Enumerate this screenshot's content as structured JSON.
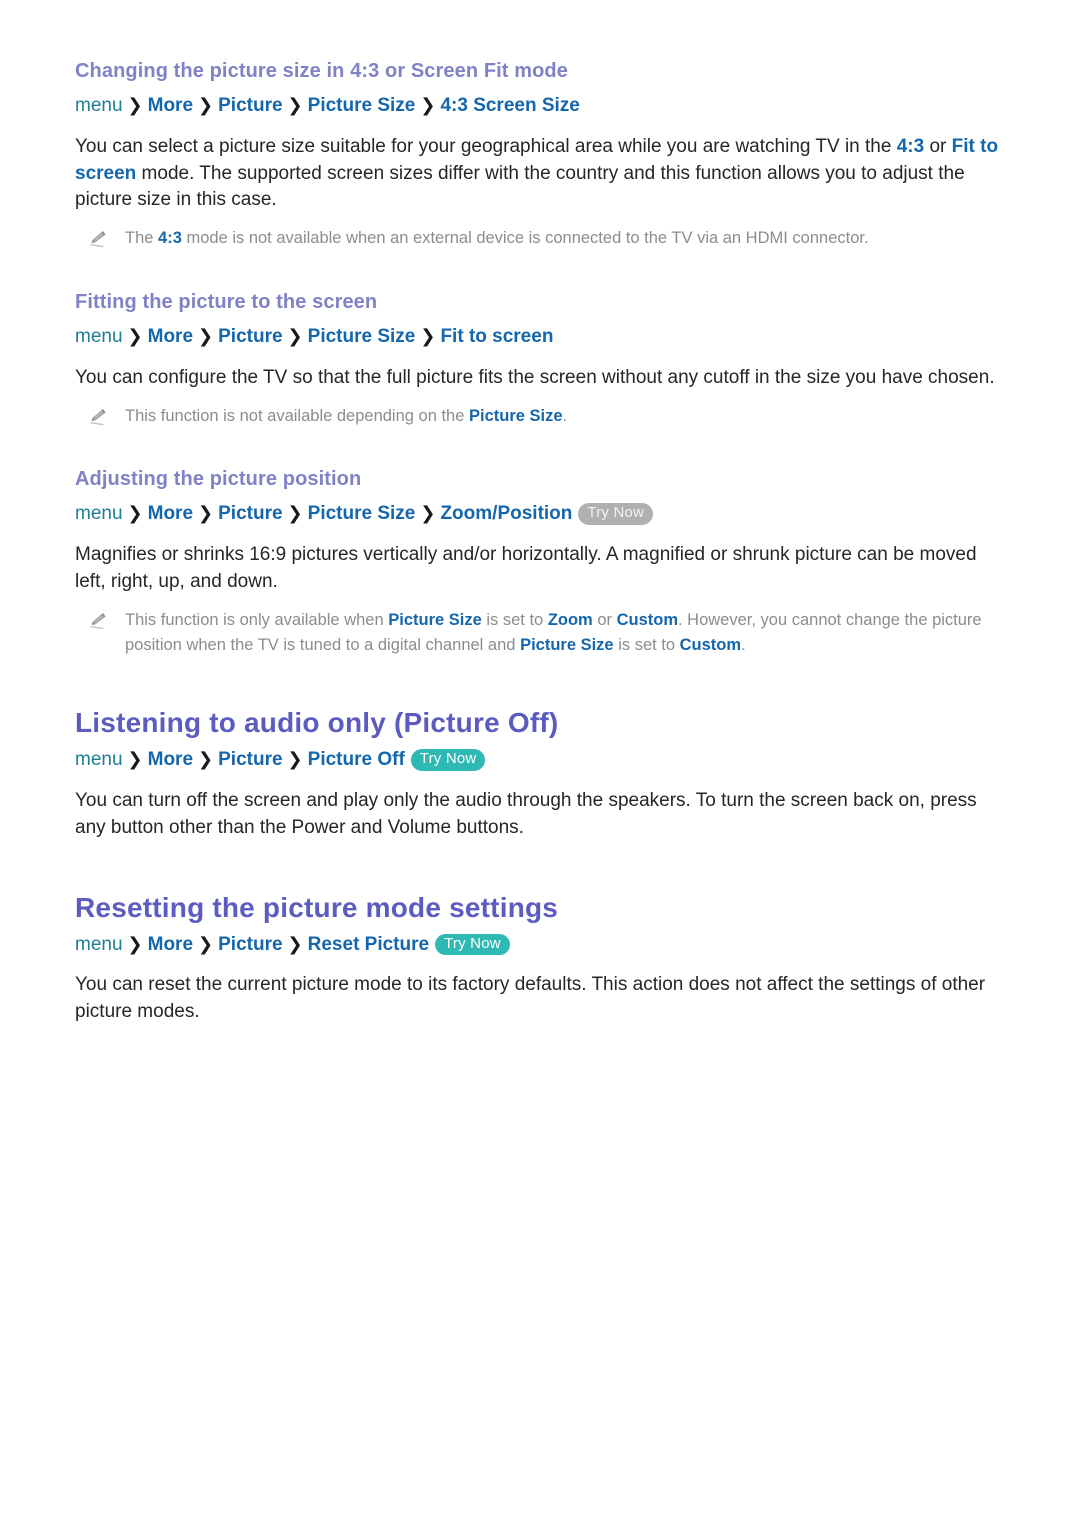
{
  "colors": {
    "main_heading": "#5c5cc0",
    "sub_heading": "#8181c6",
    "crumb_menu": "#1d7f94",
    "crumb_link": "#1466ad",
    "highlight": "#1466ad",
    "note_text": "#8c8c8c",
    "try_now_active": "#2fb9b5",
    "try_now_muted": "#b0b0b0",
    "body_text": "#262626",
    "page_background": "#ffffff"
  },
  "sections": [
    {
      "id": "changing-picture-size",
      "level": "sub",
      "heading": "Changing the picture size in 4:3 or Screen Fit mode",
      "breadcrumb": {
        "root": "menu",
        "separator": "›",
        "crumbs": [
          "More",
          "Picture",
          "Picture Size",
          "4:3 Screen Size"
        ],
        "try_now": null
      },
      "paragraphs": [
        {
          "runs": [
            {
              "t": "You can select a picture size suitable for your geographical area while you are watching TV in the ",
              "b": false
            },
            {
              "t": "4:3",
              "b": true
            },
            {
              "t": " or ",
              "b": false
            },
            {
              "t": "Fit to screen",
              "b": true
            },
            {
              "t": " mode. The supported screen sizes differ with the country and this function allows you to adjust the picture size in this case.",
              "b": false
            }
          ]
        }
      ],
      "notes": [
        {
          "icon": "pencil-icon",
          "runs": [
            {
              "t": "The ",
              "b": false
            },
            {
              "t": "4:3",
              "b": true
            },
            {
              "t": " mode is not available when an external device is connected to the TV via an HDMI connector.",
              "b": false
            }
          ]
        }
      ]
    },
    {
      "id": "fitting-picture-to-screen",
      "level": "sub",
      "heading": "Fitting the picture to the screen",
      "breadcrumb": {
        "root": "menu",
        "separator": "›",
        "crumbs": [
          "More",
          "Picture",
          "Picture Size",
          "Fit to screen"
        ],
        "try_now": null
      },
      "paragraphs": [
        {
          "runs": [
            {
              "t": "You can configure the TV so that the full picture fits the screen without any cutoff in the size you have chosen.",
              "b": false
            }
          ]
        }
      ],
      "notes": [
        {
          "icon": "pencil-icon",
          "runs": [
            {
              "t": "This function is not available depending on the ",
              "b": false
            },
            {
              "t": "Picture Size",
              "b": true
            },
            {
              "t": ".",
              "b": false
            }
          ]
        }
      ]
    },
    {
      "id": "adjusting-picture-position",
      "level": "sub",
      "heading": "Adjusting the picture position",
      "breadcrumb": {
        "root": "menu",
        "separator": "›",
        "crumbs": [
          "More",
          "Picture",
          "Picture Size",
          "Zoom/Position"
        ],
        "try_now": {
          "label": "Try Now",
          "style": "muted"
        }
      },
      "paragraphs": [
        {
          "runs": [
            {
              "t": "Magnifies or shrinks 16:9 pictures vertically and/or horizontally. A magnified or shrunk picture can be moved left, right, up, and down.",
              "b": false
            }
          ]
        }
      ],
      "notes": [
        {
          "icon": "pencil-icon",
          "runs": [
            {
              "t": "This function is only available when ",
              "b": false
            },
            {
              "t": "Picture Size",
              "b": true
            },
            {
              "t": " is set to ",
              "b": false
            },
            {
              "t": "Zoom",
              "b": true
            },
            {
              "t": " or ",
              "b": false
            },
            {
              "t": "Custom",
              "b": true
            },
            {
              "t": ". However, you cannot change the picture position when the TV is tuned to a digital channel and ",
              "b": false
            },
            {
              "t": "Picture Size",
              "b": true
            },
            {
              "t": " is set to ",
              "b": false
            },
            {
              "t": "Custom",
              "b": true
            },
            {
              "t": ".",
              "b": false
            }
          ]
        }
      ]
    },
    {
      "id": "listening-to-audio-only",
      "level": "main",
      "heading": "Listening to audio only (Picture Off)",
      "breadcrumb": {
        "root": "menu",
        "separator": "›",
        "crumbs": [
          "More",
          "Picture",
          "Picture Off"
        ],
        "try_now": {
          "label": "Try Now",
          "style": "active"
        }
      },
      "paragraphs": [
        {
          "runs": [
            {
              "t": "You can turn off the screen and play only the audio through the speakers. To turn the screen back on, press any button other than the Power and Volume buttons.",
              "b": false
            }
          ]
        }
      ],
      "notes": []
    },
    {
      "id": "resetting-picture-mode-settings",
      "level": "main",
      "heading": "Resetting the picture mode settings",
      "breadcrumb": {
        "root": "menu",
        "separator": "›",
        "crumbs": [
          "More",
          "Picture",
          "Reset Picture"
        ],
        "try_now": {
          "label": "Try Now",
          "style": "active"
        }
      },
      "paragraphs": [
        {
          "runs": [
            {
              "t": "You can reset the current picture mode to its factory defaults. This action does not affect the settings of other picture modes.",
              "b": false
            }
          ]
        }
      ],
      "notes": []
    }
  ]
}
